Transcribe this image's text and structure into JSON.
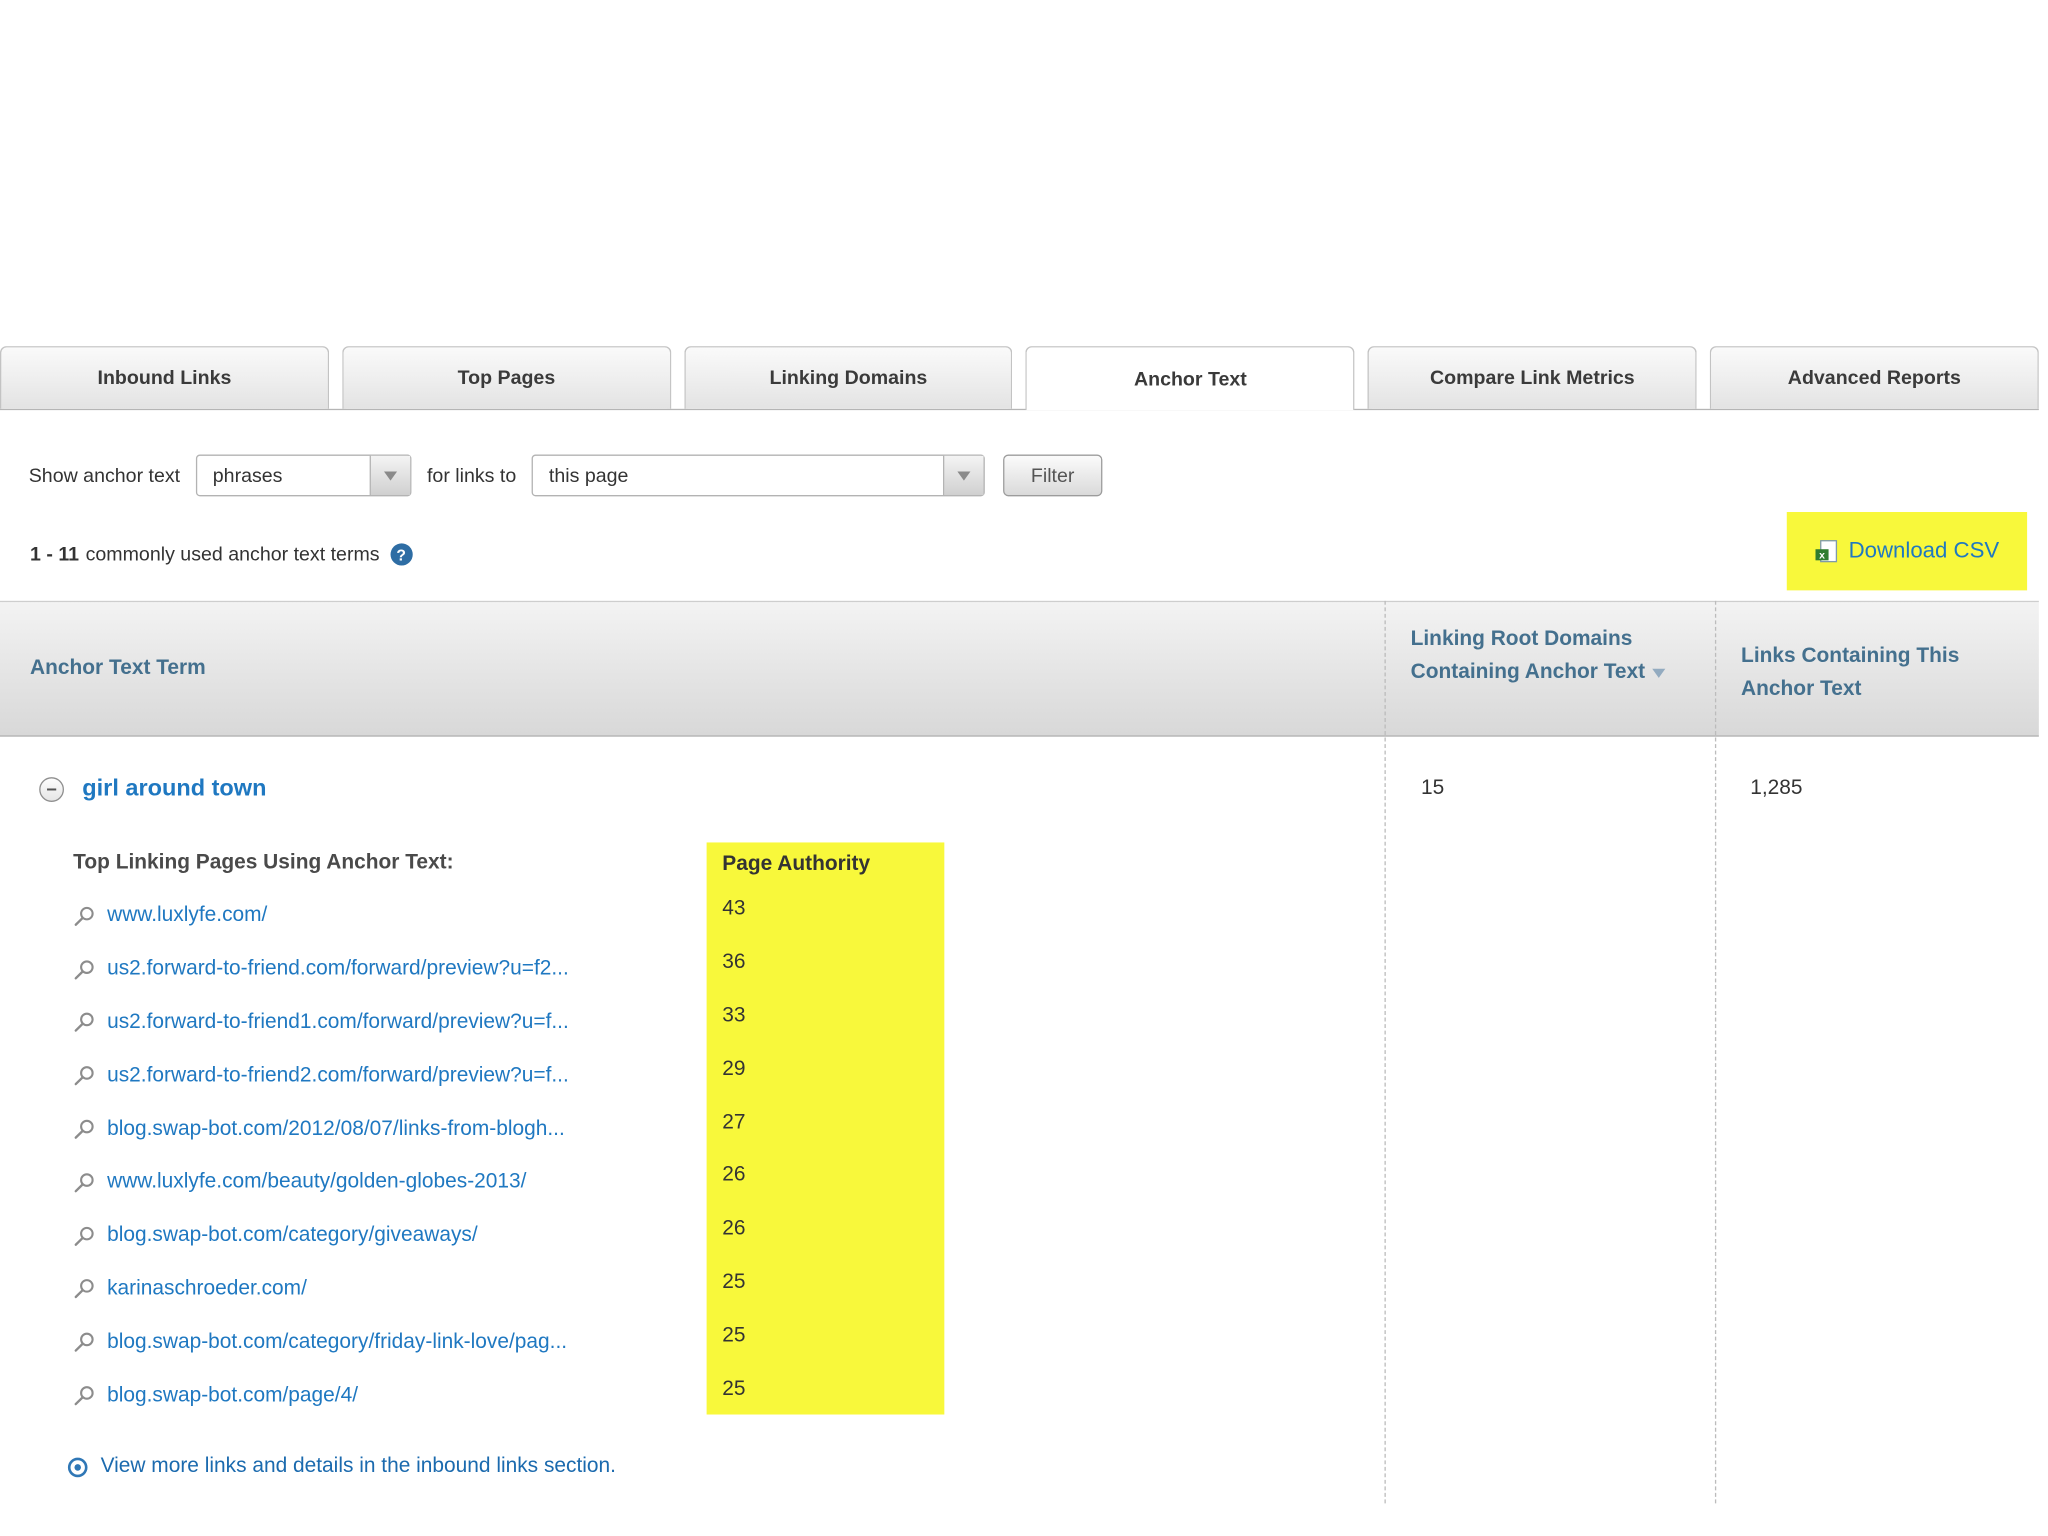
{
  "colors": {
    "highlight_yellow": "#f8f83b",
    "link_blue": "#1f78c1",
    "header_blue": "#44708e"
  },
  "icons": {
    "help_glyph": "?",
    "collapse_glyph": "−"
  },
  "tabs": [
    {
      "label": "Inbound Links",
      "active": false
    },
    {
      "label": "Top Pages",
      "active": false
    },
    {
      "label": "Linking Domains",
      "active": false
    },
    {
      "label": "Anchor Text",
      "active": true
    },
    {
      "label": "Compare Link Metrics",
      "active": false
    },
    {
      "label": "Advanced Reports",
      "active": false
    }
  ],
  "filter_bar": {
    "show_label": "Show anchor text",
    "anchor_type": "phrases",
    "for_links_label": "for links to",
    "target": "this page",
    "filter_button_label": "Filter"
  },
  "results_summary": {
    "range": "1 - 11",
    "label": "commonly used anchor text terms"
  },
  "download_csv": {
    "label": "Download CSV"
  },
  "table": {
    "header": {
      "col_term": "Anchor Text Term",
      "col_root_domains": "Linking Root Domains Containing Anchor Text",
      "col_links": "Links Containing This Anchor Text"
    },
    "row": {
      "term": "girl around town",
      "root_domains": "15",
      "links_containing": "1,285",
      "sub": {
        "title": "Top Linking Pages Using Anchor Text:",
        "pa_header": "Page Authority",
        "links": [
          {
            "url": "www.luxlyfe.com/",
            "pa": "43"
          },
          {
            "url": "us2.forward-to-friend.com/forward/preview?u=f2...",
            "pa": "36"
          },
          {
            "url": "us2.forward-to-friend1.com/forward/preview?u=f...",
            "pa": "33"
          },
          {
            "url": "us2.forward-to-friend2.com/forward/preview?u=f...",
            "pa": "29"
          },
          {
            "url": "blog.swap-bot.com/2012/08/07/links-from-blogh...",
            "pa": "27"
          },
          {
            "url": "www.luxlyfe.com/beauty/golden-globes-2013/",
            "pa": "26"
          },
          {
            "url": "blog.swap-bot.com/category/giveaways/",
            "pa": "26"
          },
          {
            "url": "karinaschroeder.com/",
            "pa": "25"
          },
          {
            "url": "blog.swap-bot.com/category/friday-link-love/pag...",
            "pa": "25"
          },
          {
            "url": "blog.swap-bot.com/page/4/",
            "pa": "25"
          }
        ]
      },
      "footer_link": "View more links and details in the inbound links section."
    }
  }
}
